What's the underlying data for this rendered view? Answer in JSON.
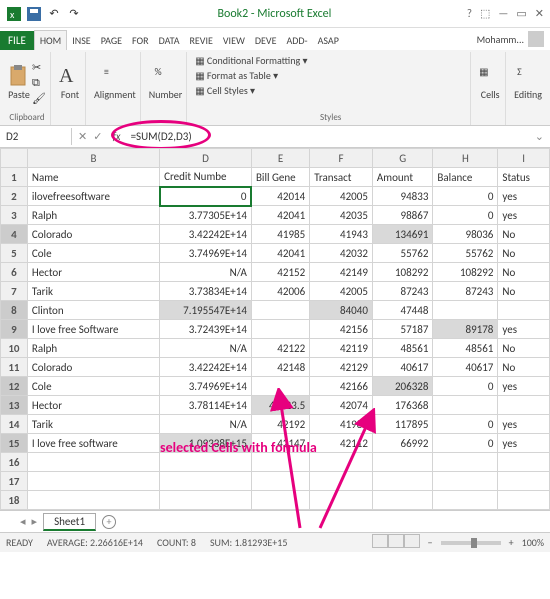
{
  "titlebar": {
    "title": "Book2 - Microsoft Excel"
  },
  "tabs": {
    "file": "FILE",
    "items": [
      "HOM",
      "INSE",
      "PAGE",
      "FOR",
      "DATA",
      "REVIE",
      "VIEW",
      "DEVE",
      "ADD-",
      "ASAP"
    ],
    "user": "Mohamm..."
  },
  "ribbon": {
    "paste": "Paste",
    "clipboard": "Clipboard",
    "font": "Font",
    "alignment": "Alignment",
    "number": "Number",
    "cond": "Conditional Formatting",
    "fmttable": "Format as Table",
    "cellstyles": "Cell Styles",
    "styles": "Styles",
    "cells": "Cells",
    "editing": "Editing"
  },
  "namebox": "D2",
  "formula": "=SUM(D2,D3)",
  "headers": {
    "b": "Name",
    "d": "Credit Numbe",
    "e": "Bill Gene",
    "f": "Transact",
    "g": "Amount",
    "h": "Balance",
    "i": "Status"
  },
  "cols": [
    "",
    "B",
    "D",
    "E",
    "F",
    "G",
    "H",
    "I"
  ],
  "rows": [
    {
      "n": 1,
      "b": "Name",
      "d": "Credit Numbe",
      "e": "Bill Gene",
      "f": "Transact",
      "g": "Amount",
      "h": "Balance",
      "i": "Status",
      "head": true
    },
    {
      "n": 2,
      "b": "ilovefreesoftware",
      "d": "0",
      "e": "42014",
      "f": "42005",
      "g": "94833",
      "h": "0",
      "i": "yes",
      "dsel": true,
      "active": true
    },
    {
      "n": 3,
      "b": "Ralph",
      "d": "3.77305E+14",
      "e": "42041",
      "f": "42035",
      "g": "98867",
      "h": "0",
      "i": "yes"
    },
    {
      "n": 4,
      "b": "Colorado",
      "d": "3.42242E+14",
      "e": "41985",
      "f": "41943",
      "g": "134691",
      "h": "98036",
      "i": "No",
      "gsel": true,
      "rowsel": true
    },
    {
      "n": 5,
      "b": "Cole",
      "d": "3.74969E+14",
      "e": "42041",
      "f": "42032",
      "g": "55762",
      "h": "55762",
      "i": "No"
    },
    {
      "n": 6,
      "b": "Hector",
      "d": "N/A",
      "e": "42152",
      "f": "42149",
      "g": "108292",
      "h": "108292",
      "i": "No"
    },
    {
      "n": 7,
      "b": "Tarik",
      "d": "3.73834E+14",
      "e": "42006",
      "f": "42005",
      "g": "87243",
      "h": "87243",
      "i": "No"
    },
    {
      "n": 8,
      "b": "Clinton",
      "d": "7.195547E+14",
      "e": "",
      "f": "84040",
      "g": "47448",
      "h": "",
      "i": "",
      "dsel": true,
      "fsel": true,
      "rowsel": true
    },
    {
      "n": 9,
      "b": "I love free Software",
      "d": "3.72439E+14",
      "e": "",
      "f": "42156",
      "g": "57187",
      "h": "89178",
      "i": "yes",
      "hsel": true,
      "rowsel": true
    },
    {
      "n": 10,
      "b": "Ralph",
      "d": "N/A",
      "e": "42122",
      "f": "42119",
      "g": "48561",
      "h": "48561",
      "i": "No"
    },
    {
      "n": 11,
      "b": "Colorado",
      "d": "3.42242E+14",
      "e": "42148",
      "f": "42129",
      "g": "40617",
      "h": "40617",
      "i": "No"
    },
    {
      "n": 12,
      "b": "Cole",
      "d": "3.74969E+14",
      "e": "",
      "f": "42166",
      "g": "206328",
      "h": "0",
      "i": "yes",
      "gsel": true,
      "rowsel": true
    },
    {
      "n": 13,
      "b": "Hector",
      "d": "3.78114E+14",
      "e": "42023.5",
      "f": "42074",
      "g": "176368",
      "h": "",
      "i": "",
      "esel": true,
      "rowsel": true
    },
    {
      "n": 14,
      "b": "Tarik",
      "d": "N/A",
      "e": "42192",
      "f": "41985",
      "g": "117895",
      "h": "0",
      "i": "yes"
    },
    {
      "n": 15,
      "b": "I love free software",
      "d": "1.09338E+15",
      "e": "42147",
      "f": "42112",
      "g": "66992",
      "h": "0",
      "i": "yes",
      "dsel": true,
      "rowsel": true
    },
    {
      "n": 16,
      "b": "",
      "d": "",
      "e": "",
      "f": "",
      "g": "",
      "h": "",
      "i": ""
    },
    {
      "n": 17,
      "b": "",
      "d": "",
      "e": "",
      "f": "",
      "g": "",
      "h": "",
      "i": ""
    },
    {
      "n": 18,
      "b": "",
      "d": "",
      "e": "",
      "f": "",
      "g": "",
      "h": "",
      "i": ""
    }
  ],
  "annotation": "selected Cells with formula",
  "sheettab": "Sheet1",
  "status": {
    "ready": "READY",
    "avg_l": "AVERAGE:",
    "avg": "2.26616E+14",
    "cnt_l": "COUNT:",
    "cnt": "8",
    "sum_l": "SUM:",
    "sum": "1.81293E+15",
    "zoom": "100%"
  }
}
